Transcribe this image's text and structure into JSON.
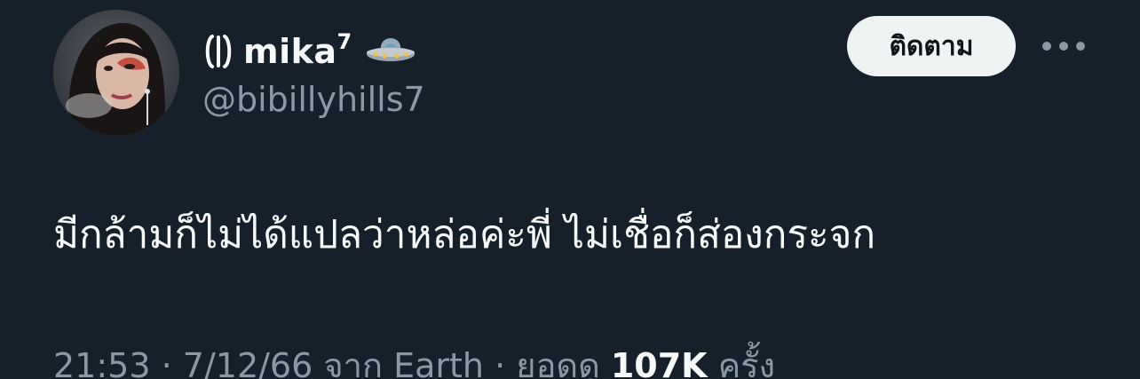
{
  "tweet": {
    "display_name": "mika",
    "display_name_sup": "7",
    "handle": "@bibillyhills7",
    "follow_label": "ติดตาม",
    "text": "มีกล้ามก็ไม่ได้แปลว่าหล่อค่ะพี่ ไม่เชื่อก็ส่องกระจก",
    "time": "21:53",
    "date": "7/12/66",
    "source_prefix": "จาก",
    "source": "Earth",
    "views_label": "ยอดดู",
    "views_count": "107K",
    "views_suffix": "ครั้ง",
    "separator": "·"
  },
  "icons": {
    "name_prefix": "bracket-icon",
    "name_suffix": "ufo-icon",
    "more": "more-horizontal-icon"
  },
  "colors": {
    "background": "#15202b",
    "primary_text": "#f7f9f9",
    "secondary_text": "#8b98a5",
    "follow_button_bg": "#eff3f4",
    "follow_button_text": "#0f1419"
  }
}
